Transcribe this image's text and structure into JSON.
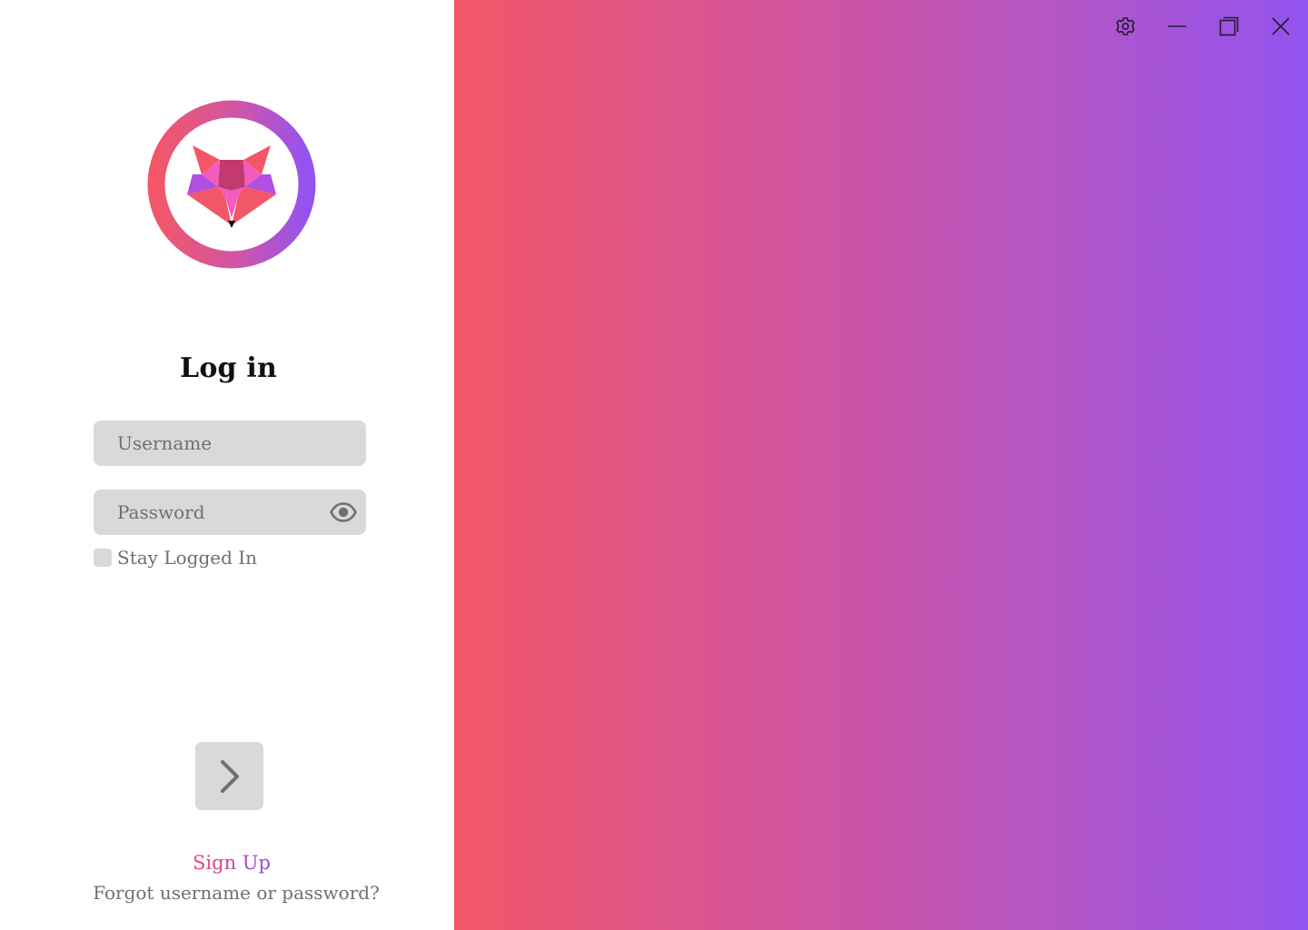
{
  "window": {
    "controls": {
      "settings_icon": "gear-icon",
      "minimize_icon": "minimize-icon",
      "maximize_icon": "restore-icon",
      "close_icon": "close-icon"
    }
  },
  "brand": {
    "logo_icon": "fox-logo-icon",
    "gradient_start": "#f25767",
    "gradient_end": "#9353f0"
  },
  "login": {
    "title": "Log in",
    "username": {
      "value": "",
      "placeholder": "Username"
    },
    "password": {
      "value": "",
      "placeholder": "Password",
      "toggle_icon": "eye-icon"
    },
    "stay_logged_in": {
      "label": "Stay Logged In",
      "checked": false
    },
    "submit_icon": "chevron-right-icon",
    "signup_label": "Sign Up",
    "forgot_label": "Forgot username or password?"
  },
  "colors": {
    "field_bg": "#d9d9d9",
    "muted_text": "#6f6f6f",
    "title_text": "#111111"
  }
}
